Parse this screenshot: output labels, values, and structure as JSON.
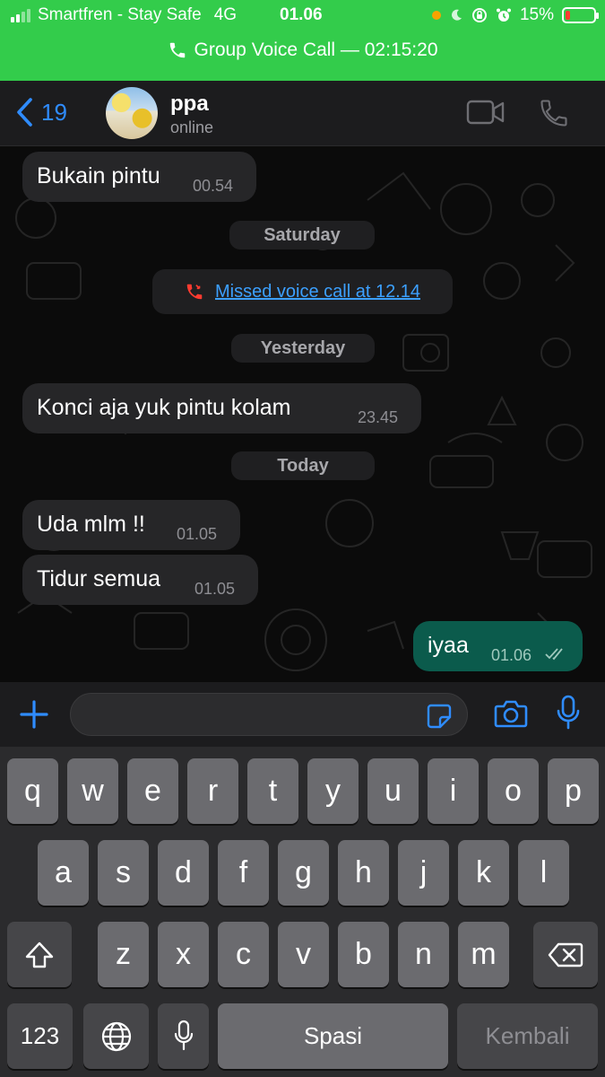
{
  "status_bar": {
    "carrier": "Smartfren - Stay Safe",
    "network": "4G",
    "time": "01.06",
    "battery_percent": "15%",
    "battery_level": 0.15
  },
  "call_banner": {
    "label": "Group Voice Call — 02:15:20"
  },
  "header": {
    "back_count": "19",
    "contact_name": "ppa",
    "contact_status": "online"
  },
  "messages": [
    {
      "text": "Bukain pintu",
      "time": "00.54",
      "direction": "in"
    },
    {
      "text": "Konci aja yuk pintu kolam",
      "time": "23.45",
      "direction": "in"
    },
    {
      "text": "Uda mlm !!",
      "time": "01.05",
      "direction": "in"
    },
    {
      "text": "Tidur semua",
      "time": "01.05",
      "direction": "in"
    },
    {
      "text": "iyaa",
      "time": "01.06",
      "direction": "out",
      "read": true
    }
  ],
  "date_separators": [
    "Saturday",
    "Yesterday",
    "Today"
  ],
  "system_messages": {
    "missed_call": "Missed voice call at 12.14"
  },
  "input": {
    "placeholder": ""
  },
  "keyboard": {
    "row1": [
      "q",
      "w",
      "e",
      "r",
      "t",
      "y",
      "u",
      "i",
      "o",
      "p"
    ],
    "row2": [
      "a",
      "s",
      "d",
      "f",
      "g",
      "h",
      "j",
      "k",
      "l"
    ],
    "row3": [
      "z",
      "x",
      "c",
      "v",
      "b",
      "n",
      "m"
    ],
    "numbers_key": "123",
    "space_key": "Spasi",
    "return_key": "Kembali"
  },
  "colors": {
    "call_banner": "#33cc4b",
    "accent_blue": "#2f8cff",
    "outgoing_bubble": "#0b5b4c",
    "incoming_bubble": "#262628",
    "missed_call_red": "#ff3b30"
  }
}
